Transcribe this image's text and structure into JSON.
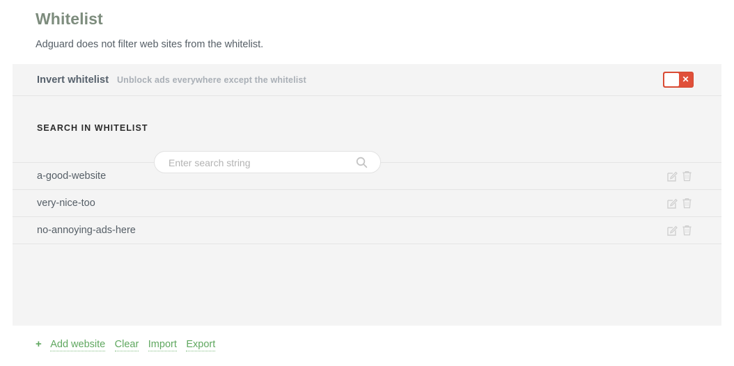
{
  "header": {
    "title": "Whitelist",
    "subtitle": "Adguard does not filter web sites from the whitelist."
  },
  "invert": {
    "label": "Invert whitelist",
    "hint": "Unblock ads everywhere except the whitelist",
    "toggle_state": "off",
    "toggle_glyph": "✕",
    "toggle_color": "#e0503a"
  },
  "search": {
    "label": "SEARCH IN WHITELIST",
    "value": "",
    "placeholder": "Enter search string",
    "icon": "search-icon"
  },
  "list": {
    "items": [
      {
        "name": "a-good-website",
        "edit_icon": "edit-icon",
        "delete_icon": "trash-icon"
      },
      {
        "name": "very-nice-too",
        "edit_icon": "edit-icon",
        "delete_icon": "trash-icon"
      },
      {
        "name": "no-annoying-ads-here",
        "edit_icon": "edit-icon",
        "delete_icon": "trash-icon"
      }
    ]
  },
  "footer": {
    "plus": "+",
    "add_website": "Add website",
    "clear": "Clear",
    "import": "Import",
    "export": "Export",
    "link_color": "#5fa75f"
  }
}
